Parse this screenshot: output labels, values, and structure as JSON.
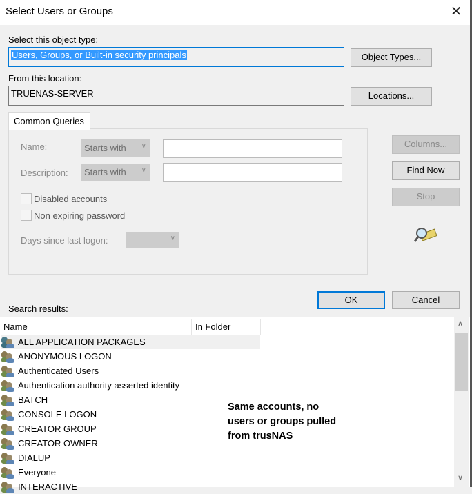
{
  "window": {
    "title": "Select Users or Groups",
    "close": "✕"
  },
  "object_type": {
    "label": "Select this object type:",
    "value": "Users, Groups, or Built-in security principals",
    "button": "Object Types..."
  },
  "location": {
    "label": "From this location:",
    "value": "TRUENAS-SERVER",
    "button": "Locations..."
  },
  "queries": {
    "tab": "Common Queries",
    "name_label": "Name:",
    "name_mode": "Starts with",
    "desc_label": "Description:",
    "desc_mode": "Starts with",
    "disabled_accounts": "Disabled accounts",
    "non_expiring": "Non expiring password",
    "days_label": "Days since last logon:",
    "columns": "Columns...",
    "find_now": "Find Now",
    "stop": "Stop"
  },
  "ok": "OK",
  "cancel": "Cancel",
  "results": {
    "label": "Search results:",
    "columns": [
      "Name",
      "In Folder"
    ],
    "rows": [
      "ALL APPLICATION PACKAGES",
      "ANONYMOUS LOGON",
      "Authenticated Users",
      "Authentication authority asserted identity",
      "BATCH",
      "CONSOLE LOGON",
      "CREATOR GROUP",
      "CREATOR OWNER",
      "DIALUP",
      "Everyone",
      "INTERACTIVE"
    ]
  },
  "annotation": [
    "Same accounts, no",
    "users or groups pulled",
    "from trusNAS"
  ]
}
